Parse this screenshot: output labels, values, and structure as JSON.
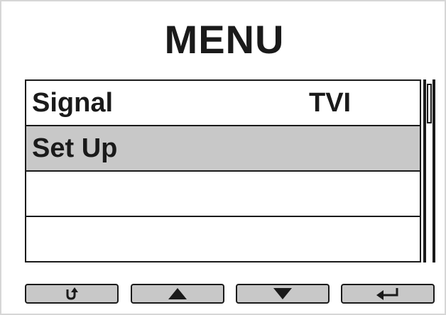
{
  "screen": {
    "title": "MENU"
  },
  "menu": {
    "items": [
      {
        "label": "Signal",
        "value": "TVI",
        "selected": false
      },
      {
        "label": "Set Up",
        "value": "",
        "selected": true
      },
      {
        "label": "",
        "value": "",
        "selected": false
      },
      {
        "label": "",
        "value": "",
        "selected": false
      }
    ]
  },
  "softkeys": [
    {
      "icon": "return-icon"
    },
    {
      "icon": "up-arrow-icon"
    },
    {
      "icon": "down-arrow-icon"
    },
    {
      "icon": "enter-icon"
    }
  ],
  "colors": {
    "selected_row": "#c8c8c8",
    "button_fill": "#c8c8c8",
    "ink": "#1a1a1a"
  }
}
